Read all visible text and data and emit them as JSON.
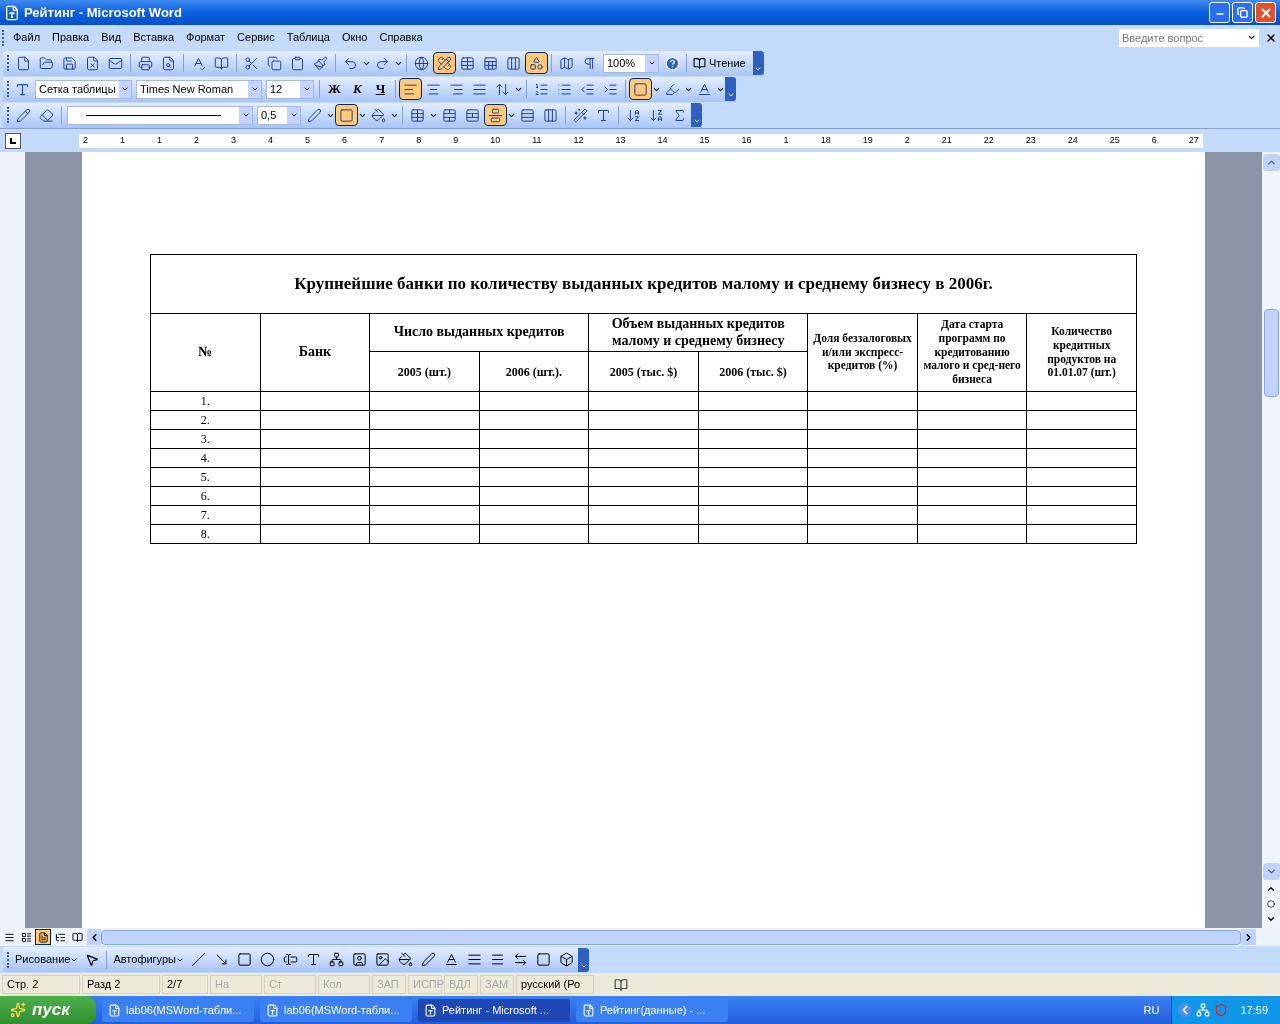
{
  "window": {
    "title": "Рейтинг - Microsoft Word"
  },
  "menu": [
    "Файл",
    "Правка",
    "Вид",
    "Вставка",
    "Формат",
    "Сервис",
    "Таблица",
    "Окно",
    "Справка"
  ],
  "help_field": {
    "placeholder": "Введите вопрос"
  },
  "standard_toolbar": {
    "buttons": [
      {
        "pressed": false
      },
      {
        "pressed": false
      },
      {
        "pressed": false
      },
      {
        "pressed": false
      },
      {
        "pressed": false
      },
      {
        "pressed": false
      },
      {
        "pressed": false
      },
      {
        "pressed": false
      },
      {
        "pressed": false
      },
      {
        "pressed": false
      },
      {
        "pressed": false
      },
      {
        "pressed": false
      },
      {
        "pressed": false
      },
      {
        "pressed": false
      },
      {
        "pressed": false
      },
      {
        "pressed": false
      },
      {
        "pressed": true
      },
      {
        "pressed": false
      },
      {
        "pressed": false
      },
      {
        "pressed": false
      },
      {
        "pressed": true
      },
      {
        "pressed": false
      },
      {
        "pressed": false
      }
    ],
    "zoom": "100%",
    "reading_button": "Чтение"
  },
  "formatting_toolbar": {
    "style": "Сетка таблицы",
    "font": "Times New Roman",
    "size": "12",
    "font_style_buttons": [
      {
        "label": "Ж",
        "pressed": false
      },
      {
        "label": "К",
        "pressed": false
      },
      {
        "label": "Ч",
        "pressed": false
      }
    ],
    "buttons": [
      {
        "pressed": true
      },
      {
        "pressed": false
      },
      {
        "pressed": false
      },
      {
        "pressed": false
      },
      {
        "pressed": false
      },
      {
        "pressed": false
      },
      {
        "pressed": false
      },
      {
        "pressed": false
      },
      {
        "pressed": false
      },
      {
        "pressed": true
      },
      {
        "pressed": false
      },
      {
        "pressed": false
      }
    ]
  },
  "tables_toolbar": {
    "line_weight": "0,5",
    "buttons": [
      {
        "pressed": false
      },
      {
        "pressed": false
      },
      {
        "pressed": false
      },
      {
        "pressed": true
      },
      {
        "pressed": false
      },
      {
        "pressed": false
      },
      {
        "pressed": false
      },
      {
        "pressed": false
      },
      {
        "pressed": true
      },
      {
        "pressed": false
      },
      {
        "pressed": false
      },
      {
        "pressed": false
      },
      {
        "pressed": false
      },
      {
        "pressed": false
      },
      {
        "pressed": false
      },
      {
        "pressed": false
      }
    ]
  },
  "ruler": [
    "2",
    "1",
    "1",
    "2",
    "3",
    "4",
    "5",
    "6",
    "7",
    "8",
    "9",
    "10",
    "11",
    "12",
    "13",
    "14",
    "15",
    "16",
    "1",
    "18",
    "19",
    "2",
    "21",
    "22",
    "23",
    "24",
    "25",
    "6",
    "27"
  ],
  "table": {
    "title": "Крупнейшие банки по количеству выданных кредитов малому и среднему бизнесу в 2006г.",
    "columns": [
      {
        "label": "№"
      },
      {
        "label": "Банк"
      },
      {
        "label": "Число выданных кредитов",
        "subcolumns": [
          "2005 (шт.)",
          "2006 (шт.)."
        ]
      },
      {
        "label": "Объем выданных кредитов малому и среднему бизнесу",
        "subcolumns": [
          "2005 (тыс. $)",
          "2006 (тыс. $)"
        ]
      },
      {
        "label": "Доля беззалоговых и/или экспресс-кредитов (%)"
      },
      {
        "label": "Дата старта программ по кредитованию малого и сред-него бизнеса"
      },
      {
        "label": "Количество кредитных продуктов на 01.01.07 (шт.)"
      }
    ],
    "rows": [
      {
        "number": "1."
      },
      {
        "number": "2."
      },
      {
        "number": "3."
      },
      {
        "number": "4."
      },
      {
        "number": "5."
      },
      {
        "number": "6."
      },
      {
        "number": "7."
      },
      {
        "number": "8."
      }
    ]
  },
  "view_buttons": [
    {
      "selected": false
    },
    {
      "selected": false
    },
    {
      "selected": true
    },
    {
      "selected": false
    },
    {
      "selected": false
    }
  ],
  "drawing_toolbar": {
    "draw_menu": "Рисование",
    "autoshapes_menu": "Автофигуры"
  },
  "status_bar": [
    {
      "text": "Стр. 2",
      "disabled": false
    },
    {
      "text": "Разд 2",
      "disabled": false
    },
    {
      "text": "2/7",
      "disabled": false
    },
    {
      "text": "На",
      "disabled": true
    },
    {
      "text": "Ст",
      "disabled": true
    },
    {
      "text": "Кол",
      "disabled": true
    },
    {
      "text": "ЗАП",
      "disabled": true
    },
    {
      "text": "ИСПР",
      "disabled": true
    },
    {
      "text": "ВДЛ",
      "disabled": true
    },
    {
      "text": "ЗАМ",
      "disabled": true
    },
    {
      "text": "русский (Ро",
      "disabled": false
    }
  ],
  "taskbar": {
    "start": "пуск",
    "tasks": [
      {
        "label": "lab06(MSWord-табли...",
        "selected": false
      },
      {
        "label": "lab06(MSWord-табли...",
        "selected": false
      },
      {
        "label": "Рейтинг - Microsoft ...",
        "selected": true
      },
      {
        "label": "Рейтинг(данные) - ...",
        "selected": false
      }
    ],
    "language": "RU",
    "clock": "17:59"
  }
}
